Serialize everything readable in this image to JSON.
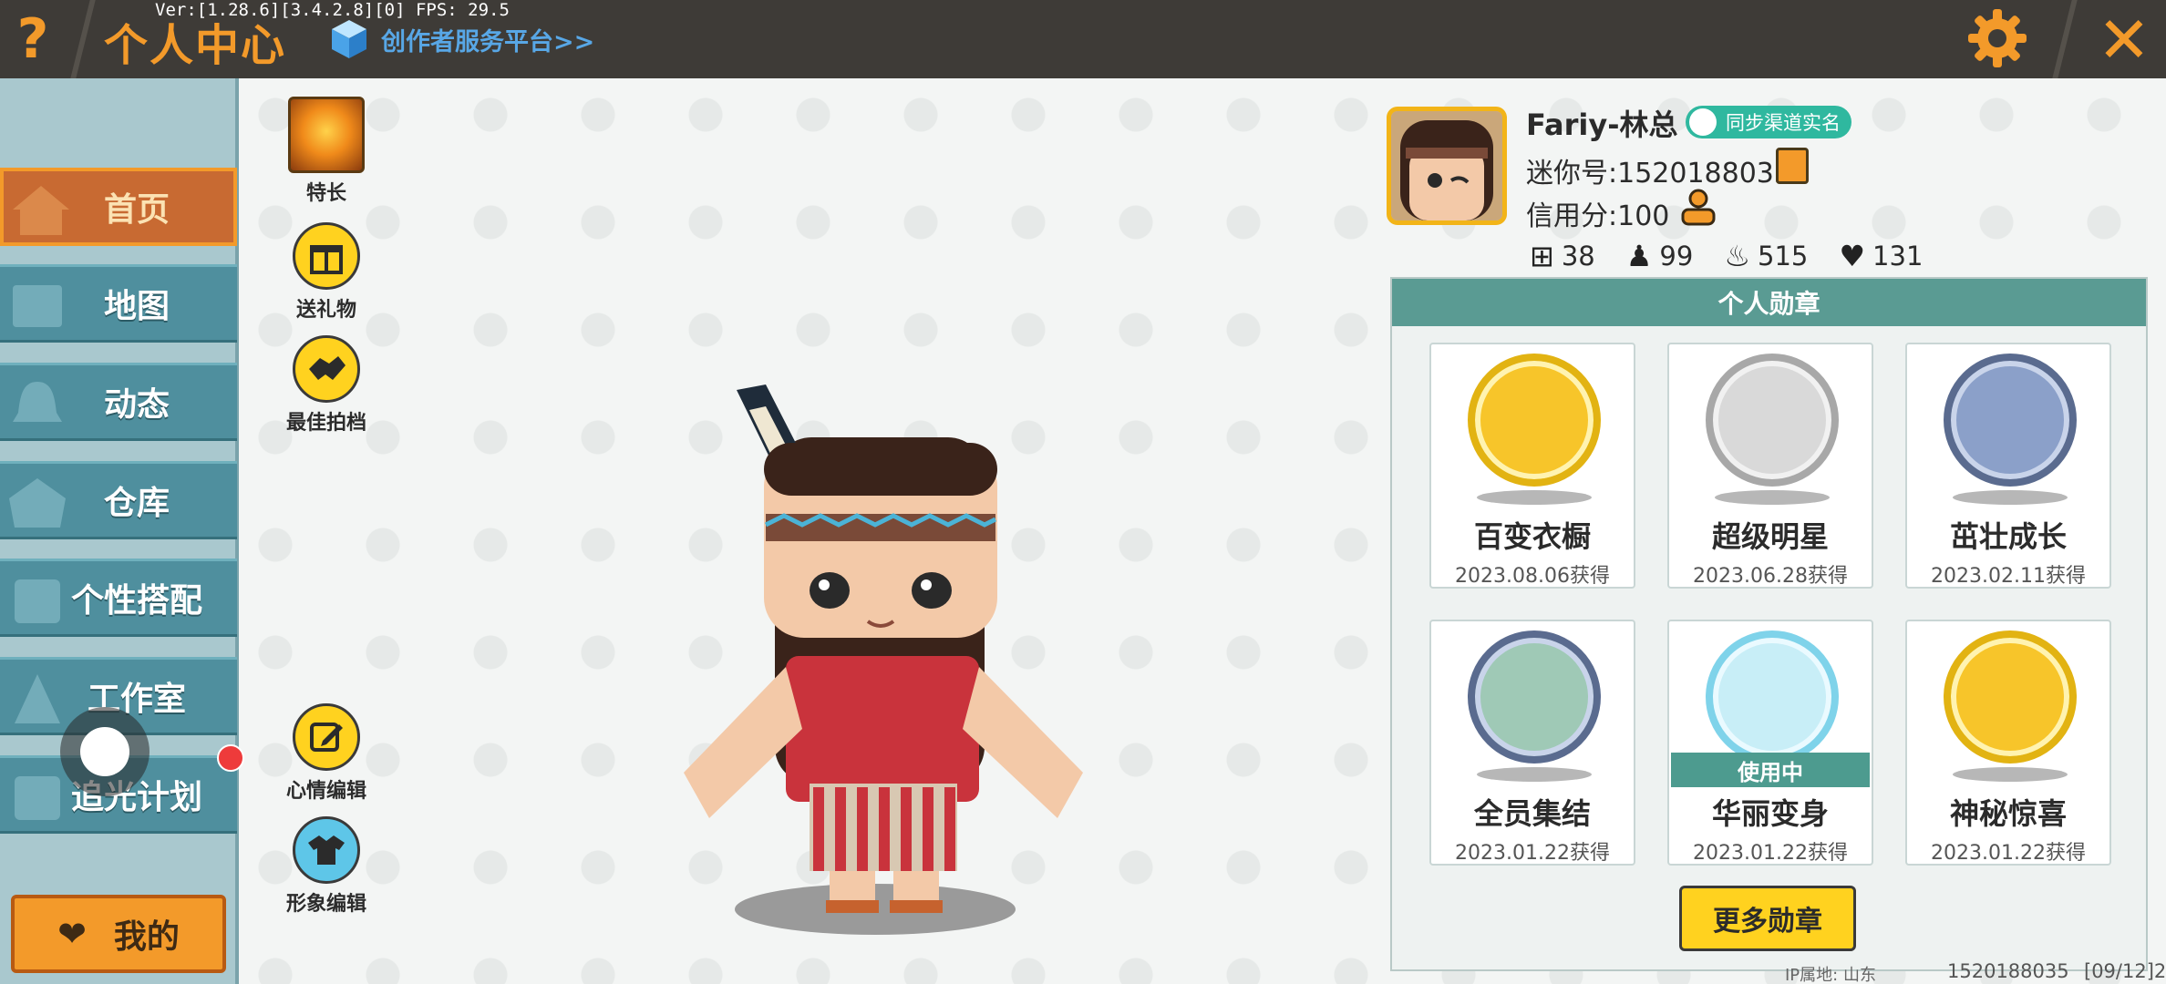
{
  "topbar": {
    "title": "个人中心",
    "version": "Ver:[1.28.6][3.4.2.8][0] FPS: 29.5",
    "creator_link": "创作者服务平台>>",
    "help_icon": "?",
    "close_icon": "✕"
  },
  "sidebar": {
    "items": [
      {
        "label": "首页",
        "icon": "house-icon"
      },
      {
        "label": "地图",
        "icon": "map-icon"
      },
      {
        "label": "动态",
        "icon": "bell-icon"
      },
      {
        "label": "仓库",
        "icon": "warehouse-icon"
      },
      {
        "label": "个性搭配",
        "icon": "outfit-icon"
      },
      {
        "label": "工作室",
        "icon": "studio-icon"
      },
      {
        "label": "追光计划",
        "icon": "light-icon"
      }
    ],
    "mine_button": "我的"
  },
  "actions": {
    "talent": "特长",
    "gift": "送礼物",
    "partner": "最佳拍档",
    "mood": "心情编辑",
    "appearance": "形象编辑"
  },
  "profile": {
    "username": "Fariy-林总",
    "realname_badge": "同步渠道实名",
    "mini_id": "迷你号:1520188035",
    "credit": "信用分:100",
    "stats": [
      {
        "icon": "plus-square-icon",
        "value": "38"
      },
      {
        "icon": "fans-icon",
        "value": "99"
      },
      {
        "icon": "fire-icon",
        "value": "515"
      },
      {
        "icon": "heart-icon",
        "value": "131"
      }
    ]
  },
  "medals": {
    "header": "个人勋章",
    "items": [
      {
        "name": "百变衣橱",
        "date": "2023.08.06获得",
        "ring": "#e2b312"
      },
      {
        "name": "超级明星",
        "date": "2023.06.28获得",
        "ring": "#a8a8a8"
      },
      {
        "name": "茁壮成长",
        "date": "2023.02.11获得",
        "ring": "#5a6b8f"
      },
      {
        "name": "全员集结",
        "date": "2023.01.22获得",
        "ring": "#5a6b8f"
      },
      {
        "name": "华丽变身",
        "date": "2023.01.22获得",
        "ring": "#7fd3ea",
        "badge": "使用中"
      },
      {
        "name": "神秘惊喜",
        "date": "2023.01.22获得",
        "ring": "#e2b312"
      }
    ],
    "more_button": "更多勋章"
  },
  "footer": {
    "ip": "IP属地: 山东",
    "id": "1520188035",
    "date": "[09/12]2"
  },
  "colors": {
    "accent_orange": "#f39a2a",
    "sidebar_teal": "#4f8f9e",
    "medal_header": "#5a9b93",
    "yellow_button": "#ffd21f"
  }
}
